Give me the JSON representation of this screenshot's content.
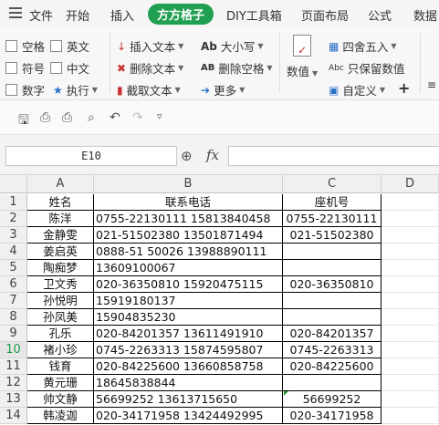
{
  "menu": {
    "items": [
      "文件",
      "开始",
      "插入",
      "方方格子",
      "DIY工具箱",
      "页面布局",
      "公式",
      "数据"
    ],
    "active_index": 3
  },
  "ribbon": {
    "checkboxes": [
      "空格",
      "英文",
      "符号",
      "中文",
      "数字"
    ],
    "execute": "执行",
    "insert_text": "插入文本",
    "delete_text": "删除文本",
    "extract_text": "截取文本",
    "case": "大小写",
    "delete_space": "删除空格",
    "more": "更多",
    "value": "数值",
    "round": "四舍五入",
    "keep_value": "只保留数值",
    "custom": "自定义",
    "plus": "+"
  },
  "namebox": {
    "value": "E10"
  },
  "formula": {
    "fx": "fx",
    "value": ""
  },
  "columns": [
    "A",
    "B",
    "C",
    "D"
  ],
  "rows": [
    {
      "n": "1",
      "a": "姓名",
      "b": "联系电话",
      "c": "座机号"
    },
    {
      "n": "2",
      "a": "陈洋",
      "b": "0755-22130111 15813840458",
      "c": "0755-22130111"
    },
    {
      "n": "3",
      "a": "金静雯",
      "b": "021-51502380 13501871494",
      "c": "021-51502380"
    },
    {
      "n": "4",
      "a": "姜启英",
      "b": "0888-51 50026 13988890111",
      "c": ""
    },
    {
      "n": "5",
      "a": "陶痴梦",
      "b": "13609100067",
      "c": ""
    },
    {
      "n": "6",
      "a": "卫文秀",
      "b": "020-36350810 15920475115",
      "c": "020-36350810"
    },
    {
      "n": "7",
      "a": "孙悦明",
      "b": "15919180137",
      "c": ""
    },
    {
      "n": "8",
      "a": "孙凤美",
      "b": "15904835230",
      "c": ""
    },
    {
      "n": "9",
      "a": "孔乐",
      "b": "020-84201357 13611491910",
      "c": "020-84201357"
    },
    {
      "n": "10",
      "a": "褚小珍",
      "b": "0745-2263313 15874595807",
      "c": "0745-2263313"
    },
    {
      "n": "11",
      "a": "钱育",
      "b": "020-84225600 13660858758",
      "c": "020-84225600"
    },
    {
      "n": "12",
      "a": "黄元珊",
      "b": "18645838844",
      "c": ""
    },
    {
      "n": "13",
      "a": "帅文静",
      "b": "56699252 13613715650",
      "c": "56699252"
    },
    {
      "n": "14",
      "a": "韩凌迦",
      "b": "020-34171958 13424492995",
      "c": "020-34171958"
    }
  ],
  "colors": {
    "accent": "#20a050"
  }
}
